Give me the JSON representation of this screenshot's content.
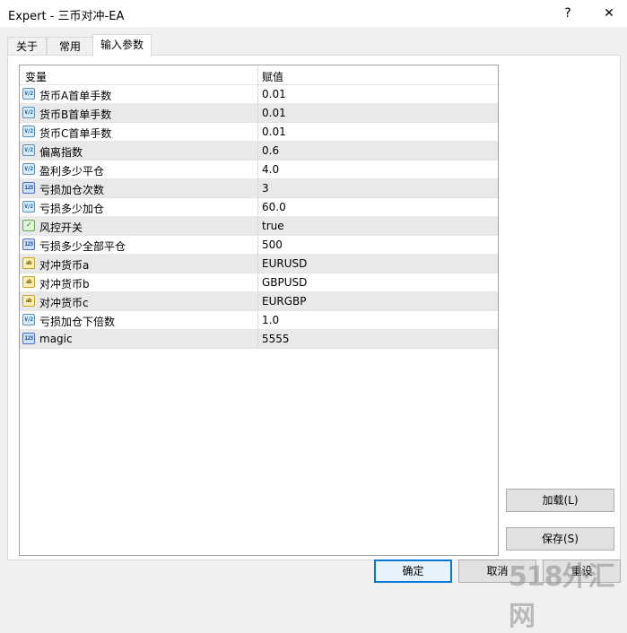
{
  "window": {
    "title": "Expert - 三币对冲-EA",
    "help": "?",
    "close": "✕"
  },
  "tabs": [
    {
      "label": "关于"
    },
    {
      "label": "常用"
    },
    {
      "label": "输入参数"
    }
  ],
  "grid": {
    "columns": {
      "variable": "变量",
      "value": "赋值"
    },
    "rows": [
      {
        "icon": "double-type-icon",
        "icon_text": "V/2",
        "name": "货币A首单手数",
        "value": "0.01"
      },
      {
        "icon": "double-type-icon",
        "icon_text": "V/2",
        "name": "货币B首单手数",
        "value": "0.01"
      },
      {
        "icon": "double-type-icon",
        "icon_text": "V/2",
        "name": "货币C首单手数",
        "value": "0.01"
      },
      {
        "icon": "double-type-icon",
        "icon_text": "V/2",
        "name": "偏离指数",
        "value": "0.6"
      },
      {
        "icon": "double-type-icon",
        "icon_text": "V/2",
        "name": "盈利多少平仓",
        "value": "4.0"
      },
      {
        "icon": "integer-type-icon",
        "icon_text": "123",
        "name": "亏损加仓次数",
        "value": "3"
      },
      {
        "icon": "double-type-icon",
        "icon_text": "V/2",
        "name": "亏损多少加仓",
        "value": "60.0"
      },
      {
        "icon": "bool-type-icon",
        "icon_text": "✓",
        "name": "风控开关",
        "value": "true"
      },
      {
        "icon": "integer-type-icon",
        "icon_text": "123",
        "name": "亏损多少全部平仓",
        "value": "500"
      },
      {
        "icon": "string-type-icon",
        "icon_text": "ab",
        "name": "对冲货币a",
        "value": "EURUSD"
      },
      {
        "icon": "string-type-icon",
        "icon_text": "ab",
        "name": "对冲货币b",
        "value": "GBPUSD"
      },
      {
        "icon": "string-type-icon",
        "icon_text": "ab",
        "name": "对冲货币c",
        "value": "EURGBP"
      },
      {
        "icon": "double-type-icon",
        "icon_text": "V/2",
        "name": "亏损加仓下倍数",
        "value": "1.0"
      },
      {
        "icon": "integer-type-icon",
        "icon_text": "123",
        "name": "magic",
        "value": "5555"
      }
    ]
  },
  "buttons": {
    "load": "加载(L)",
    "save": "保存(S)",
    "ok": "确定",
    "cancel": "取消",
    "reset": "重设"
  },
  "watermark": "518外汇网"
}
